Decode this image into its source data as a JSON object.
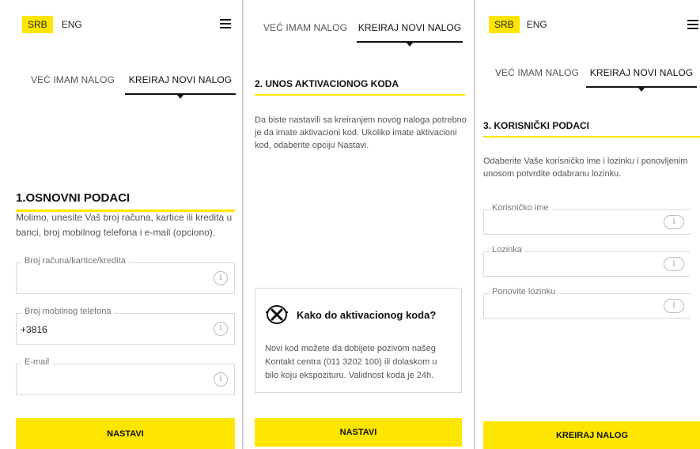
{
  "colors": {
    "accent": "#ffe600",
    "text": "#333333",
    "border": "#d8d8d8"
  },
  "lang": {
    "srb": "SRB",
    "eng": "ENG"
  },
  "tabs": {
    "existing": "VEĆ IMAM NALOG",
    "create": "KREIRAJ NOVI NALOG"
  },
  "step1": {
    "title": "1.OSNOVNI PODACI",
    "description": "Molimo, unesite Vaš broj računa, kartice ili kredita u banci, broj mobilnog telefona i e-mail (opciono).",
    "fields": [
      {
        "label": "Broj računa/kartice/kredita",
        "value": ""
      },
      {
        "label": "Broj mobilnog telefona",
        "value": "+3816"
      },
      {
        "label": "E-mail",
        "value": ""
      }
    ],
    "button": "NASTAVI"
  },
  "step2": {
    "title": "2. UNOS AKTIVACIONOG KODA",
    "description": "Da biste nastavili sa kreiranjem novog naloga potrebno je da imate aktivacioni kod. Ukoliko imate aktivacioni kod, odaberite opciju Nastavi.",
    "help_title": "Kako do aktivacionog koda?",
    "help_text": "Novi kod možete da dobijete pozivom našeg Kontakt centra (011 3202 100) ili dolaskom u bilo koju ekspozituru. Validnost koda je 24h.",
    "help_icon": "tools-icon",
    "button": "NASTAVI"
  },
  "step3": {
    "title": "3. KORISNIČKI PODACI",
    "description": "Odaberite Vaše korisničko ime i lozinku i ponovljenim unosom potvrdite odabranu lozinku.",
    "fields": [
      {
        "label": "Korisničko ime",
        "value": ""
      },
      {
        "label": "Lozinka",
        "value": ""
      },
      {
        "label": "Ponovite lozinku",
        "value": ""
      }
    ],
    "button": "KREIRAJ NALOG"
  },
  "info_glyph": "i"
}
